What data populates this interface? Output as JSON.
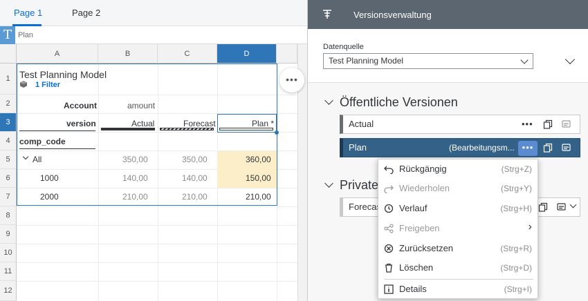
{
  "sheet": {
    "tabs": [
      {
        "label": "Page 1"
      },
      {
        "label": "Page 2"
      }
    ],
    "formula_icon": "T",
    "cell_name": "Plan",
    "columns": [
      "A",
      "B",
      "C",
      "D"
    ],
    "rows": [
      "1",
      "2",
      "3",
      "4",
      "5",
      "6",
      "7",
      "8",
      "9",
      "10",
      "11",
      "12"
    ],
    "table_title": "Test Planning Model",
    "filter_label": "1 Filter",
    "account_label": "Account",
    "amount_label": "amount",
    "version_label": "version",
    "version_headers": [
      "Actual",
      "Forecast",
      "Plan *"
    ],
    "comp_code_label": "comp_code",
    "row_labels": [
      "All",
      "1000",
      "2000"
    ],
    "values": [
      [
        "350,00",
        "350,00",
        "360,00"
      ],
      [
        "140,00",
        "140,00",
        "150,00"
      ],
      [
        "210,00",
        "210,00",
        "210,00"
      ]
    ],
    "side_button": "•••"
  },
  "panel": {
    "title": "Versionsverwaltung",
    "datasource_label": "Datenquelle",
    "datasource_value": "Test Planning Model",
    "public_section": "Öffentliche Versionen",
    "private_section": "Private",
    "versions": [
      {
        "label": "Actual",
        "status": ""
      },
      {
        "label": "Plan",
        "status": "(Bearbeitungsm..."
      }
    ],
    "private_versions": [
      {
        "label": "Forecas"
      }
    ],
    "more_label": "•••"
  },
  "menu": {
    "items": [
      {
        "label": "Rückgängig",
        "shortcut": "(Strg+Z)",
        "icon": "undo-icon",
        "disabled": false
      },
      {
        "label": "Wiederholen",
        "shortcut": "(Strg+Y)",
        "icon": "redo-icon",
        "disabled": true
      },
      {
        "label": "Verlauf",
        "shortcut": "(Strg+H)",
        "icon": "history-icon",
        "disabled": false
      },
      {
        "label": "Freigeben",
        "shortcut": "›",
        "icon": "share-icon",
        "disabled": true
      },
      {
        "label": "Zurücksetzen",
        "shortcut": "(Strg+R)",
        "icon": "reset-icon",
        "disabled": false
      },
      {
        "label": "Löschen",
        "shortcut": "(Strg+D)",
        "icon": "delete-icon",
        "disabled": false
      },
      {
        "label": "Details",
        "shortcut": "(Strg+I)",
        "icon": "details-icon",
        "disabled": false
      }
    ]
  },
  "colors": {
    "accent": "#0a6ed1",
    "selected_version": "#346187",
    "header": "#5b6670",
    "highlight": "#fbeec8"
  }
}
